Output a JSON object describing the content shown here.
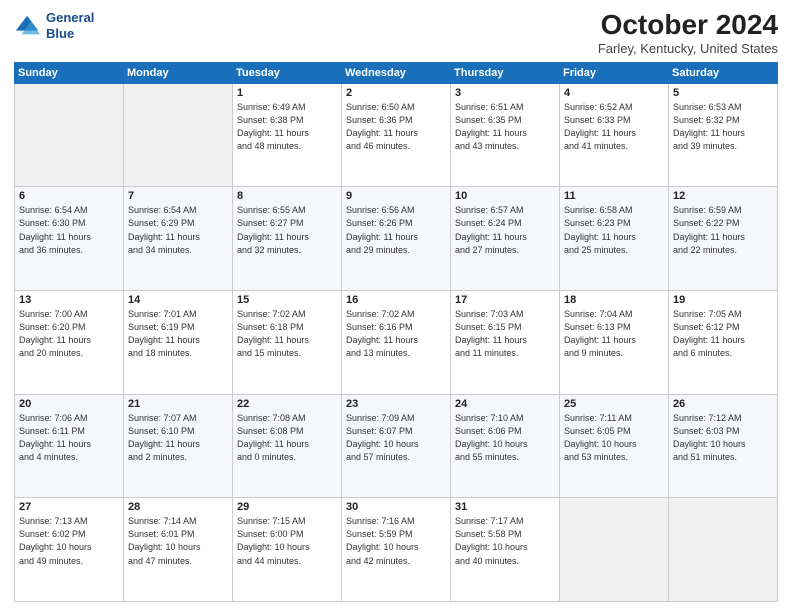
{
  "header": {
    "logo_line1": "General",
    "logo_line2": "Blue",
    "month": "October 2024",
    "location": "Farley, Kentucky, United States"
  },
  "weekdays": [
    "Sunday",
    "Monday",
    "Tuesday",
    "Wednesday",
    "Thursday",
    "Friday",
    "Saturday"
  ],
  "weeks": [
    [
      {
        "day": "",
        "info": ""
      },
      {
        "day": "",
        "info": ""
      },
      {
        "day": "1",
        "info": "Sunrise: 6:49 AM\nSunset: 6:38 PM\nDaylight: 11 hours\nand 48 minutes."
      },
      {
        "day": "2",
        "info": "Sunrise: 6:50 AM\nSunset: 6:36 PM\nDaylight: 11 hours\nand 46 minutes."
      },
      {
        "day": "3",
        "info": "Sunrise: 6:51 AM\nSunset: 6:35 PM\nDaylight: 11 hours\nand 43 minutes."
      },
      {
        "day": "4",
        "info": "Sunrise: 6:52 AM\nSunset: 6:33 PM\nDaylight: 11 hours\nand 41 minutes."
      },
      {
        "day": "5",
        "info": "Sunrise: 6:53 AM\nSunset: 6:32 PM\nDaylight: 11 hours\nand 39 minutes."
      }
    ],
    [
      {
        "day": "6",
        "info": "Sunrise: 6:54 AM\nSunset: 6:30 PM\nDaylight: 11 hours\nand 36 minutes."
      },
      {
        "day": "7",
        "info": "Sunrise: 6:54 AM\nSunset: 6:29 PM\nDaylight: 11 hours\nand 34 minutes."
      },
      {
        "day": "8",
        "info": "Sunrise: 6:55 AM\nSunset: 6:27 PM\nDaylight: 11 hours\nand 32 minutes."
      },
      {
        "day": "9",
        "info": "Sunrise: 6:56 AM\nSunset: 6:26 PM\nDaylight: 11 hours\nand 29 minutes."
      },
      {
        "day": "10",
        "info": "Sunrise: 6:57 AM\nSunset: 6:24 PM\nDaylight: 11 hours\nand 27 minutes."
      },
      {
        "day": "11",
        "info": "Sunrise: 6:58 AM\nSunset: 6:23 PM\nDaylight: 11 hours\nand 25 minutes."
      },
      {
        "day": "12",
        "info": "Sunrise: 6:59 AM\nSunset: 6:22 PM\nDaylight: 11 hours\nand 22 minutes."
      }
    ],
    [
      {
        "day": "13",
        "info": "Sunrise: 7:00 AM\nSunset: 6:20 PM\nDaylight: 11 hours\nand 20 minutes."
      },
      {
        "day": "14",
        "info": "Sunrise: 7:01 AM\nSunset: 6:19 PM\nDaylight: 11 hours\nand 18 minutes."
      },
      {
        "day": "15",
        "info": "Sunrise: 7:02 AM\nSunset: 6:18 PM\nDaylight: 11 hours\nand 15 minutes."
      },
      {
        "day": "16",
        "info": "Sunrise: 7:02 AM\nSunset: 6:16 PM\nDaylight: 11 hours\nand 13 minutes."
      },
      {
        "day": "17",
        "info": "Sunrise: 7:03 AM\nSunset: 6:15 PM\nDaylight: 11 hours\nand 11 minutes."
      },
      {
        "day": "18",
        "info": "Sunrise: 7:04 AM\nSunset: 6:13 PM\nDaylight: 11 hours\nand 9 minutes."
      },
      {
        "day": "19",
        "info": "Sunrise: 7:05 AM\nSunset: 6:12 PM\nDaylight: 11 hours\nand 6 minutes."
      }
    ],
    [
      {
        "day": "20",
        "info": "Sunrise: 7:06 AM\nSunset: 6:11 PM\nDaylight: 11 hours\nand 4 minutes."
      },
      {
        "day": "21",
        "info": "Sunrise: 7:07 AM\nSunset: 6:10 PM\nDaylight: 11 hours\nand 2 minutes."
      },
      {
        "day": "22",
        "info": "Sunrise: 7:08 AM\nSunset: 6:08 PM\nDaylight: 11 hours\nand 0 minutes."
      },
      {
        "day": "23",
        "info": "Sunrise: 7:09 AM\nSunset: 6:07 PM\nDaylight: 10 hours\nand 57 minutes."
      },
      {
        "day": "24",
        "info": "Sunrise: 7:10 AM\nSunset: 6:06 PM\nDaylight: 10 hours\nand 55 minutes."
      },
      {
        "day": "25",
        "info": "Sunrise: 7:11 AM\nSunset: 6:05 PM\nDaylight: 10 hours\nand 53 minutes."
      },
      {
        "day": "26",
        "info": "Sunrise: 7:12 AM\nSunset: 6:03 PM\nDaylight: 10 hours\nand 51 minutes."
      }
    ],
    [
      {
        "day": "27",
        "info": "Sunrise: 7:13 AM\nSunset: 6:02 PM\nDaylight: 10 hours\nand 49 minutes."
      },
      {
        "day": "28",
        "info": "Sunrise: 7:14 AM\nSunset: 6:01 PM\nDaylight: 10 hours\nand 47 minutes."
      },
      {
        "day": "29",
        "info": "Sunrise: 7:15 AM\nSunset: 6:00 PM\nDaylight: 10 hours\nand 44 minutes."
      },
      {
        "day": "30",
        "info": "Sunrise: 7:16 AM\nSunset: 5:59 PM\nDaylight: 10 hours\nand 42 minutes."
      },
      {
        "day": "31",
        "info": "Sunrise: 7:17 AM\nSunset: 5:58 PM\nDaylight: 10 hours\nand 40 minutes."
      },
      {
        "day": "",
        "info": ""
      },
      {
        "day": "",
        "info": ""
      }
    ]
  ]
}
